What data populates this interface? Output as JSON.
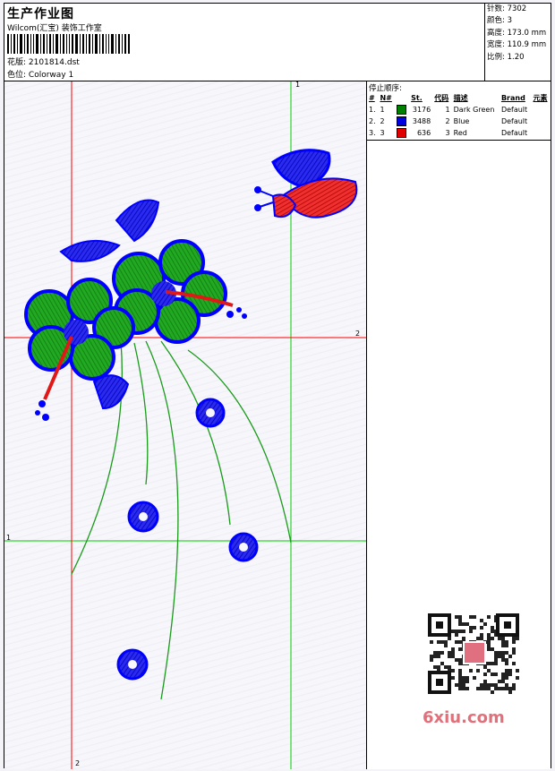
{
  "header": {
    "title": "生产作业图",
    "company": "Wilcom(汇宝) 装饰工作室",
    "design_label": "花版:",
    "design_file": "2101814.dst",
    "colorway_label": "色位:",
    "colorway": "Colorway 1"
  },
  "stats": [
    {
      "label": "针数:",
      "value": "7302"
    },
    {
      "label": "颜色:",
      "value": "3"
    },
    {
      "label": "高度:",
      "value": "173.0 mm"
    },
    {
      "label": "宽度:",
      "value": "110.9 mm"
    },
    {
      "label": "比例:",
      "value": "1.20"
    }
  ],
  "stop_sequence": {
    "title": "停止顺序:",
    "headers": [
      "#",
      "N#",
      "St.",
      "代码",
      "描述",
      "Brand",
      "元素"
    ],
    "rows": [
      {
        "idx": "1.",
        "n": "1",
        "color": "#008000",
        "st": "3176",
        "code": "1",
        "desc": "Dark Green",
        "brand": "Default"
      },
      {
        "idx": "2.",
        "n": "2",
        "color": "#0000e0",
        "st": "3488",
        "code": "2",
        "desc": "Blue",
        "brand": "Default"
      },
      {
        "idx": "3.",
        "n": "3",
        "color": "#e00000",
        "st": "636",
        "code": "3",
        "desc": "Red",
        "brand": "Default"
      }
    ]
  },
  "crosshair_labels": {
    "top": "1",
    "right": "2",
    "left": "1",
    "bottom": "2"
  },
  "watermark": "6xiu.com",
  "colors": {
    "green": "#1a9b1a",
    "blue": "#1010e8",
    "red": "#e01818",
    "guide_green": "#00cc00",
    "guide_red": "#ff0000"
  }
}
